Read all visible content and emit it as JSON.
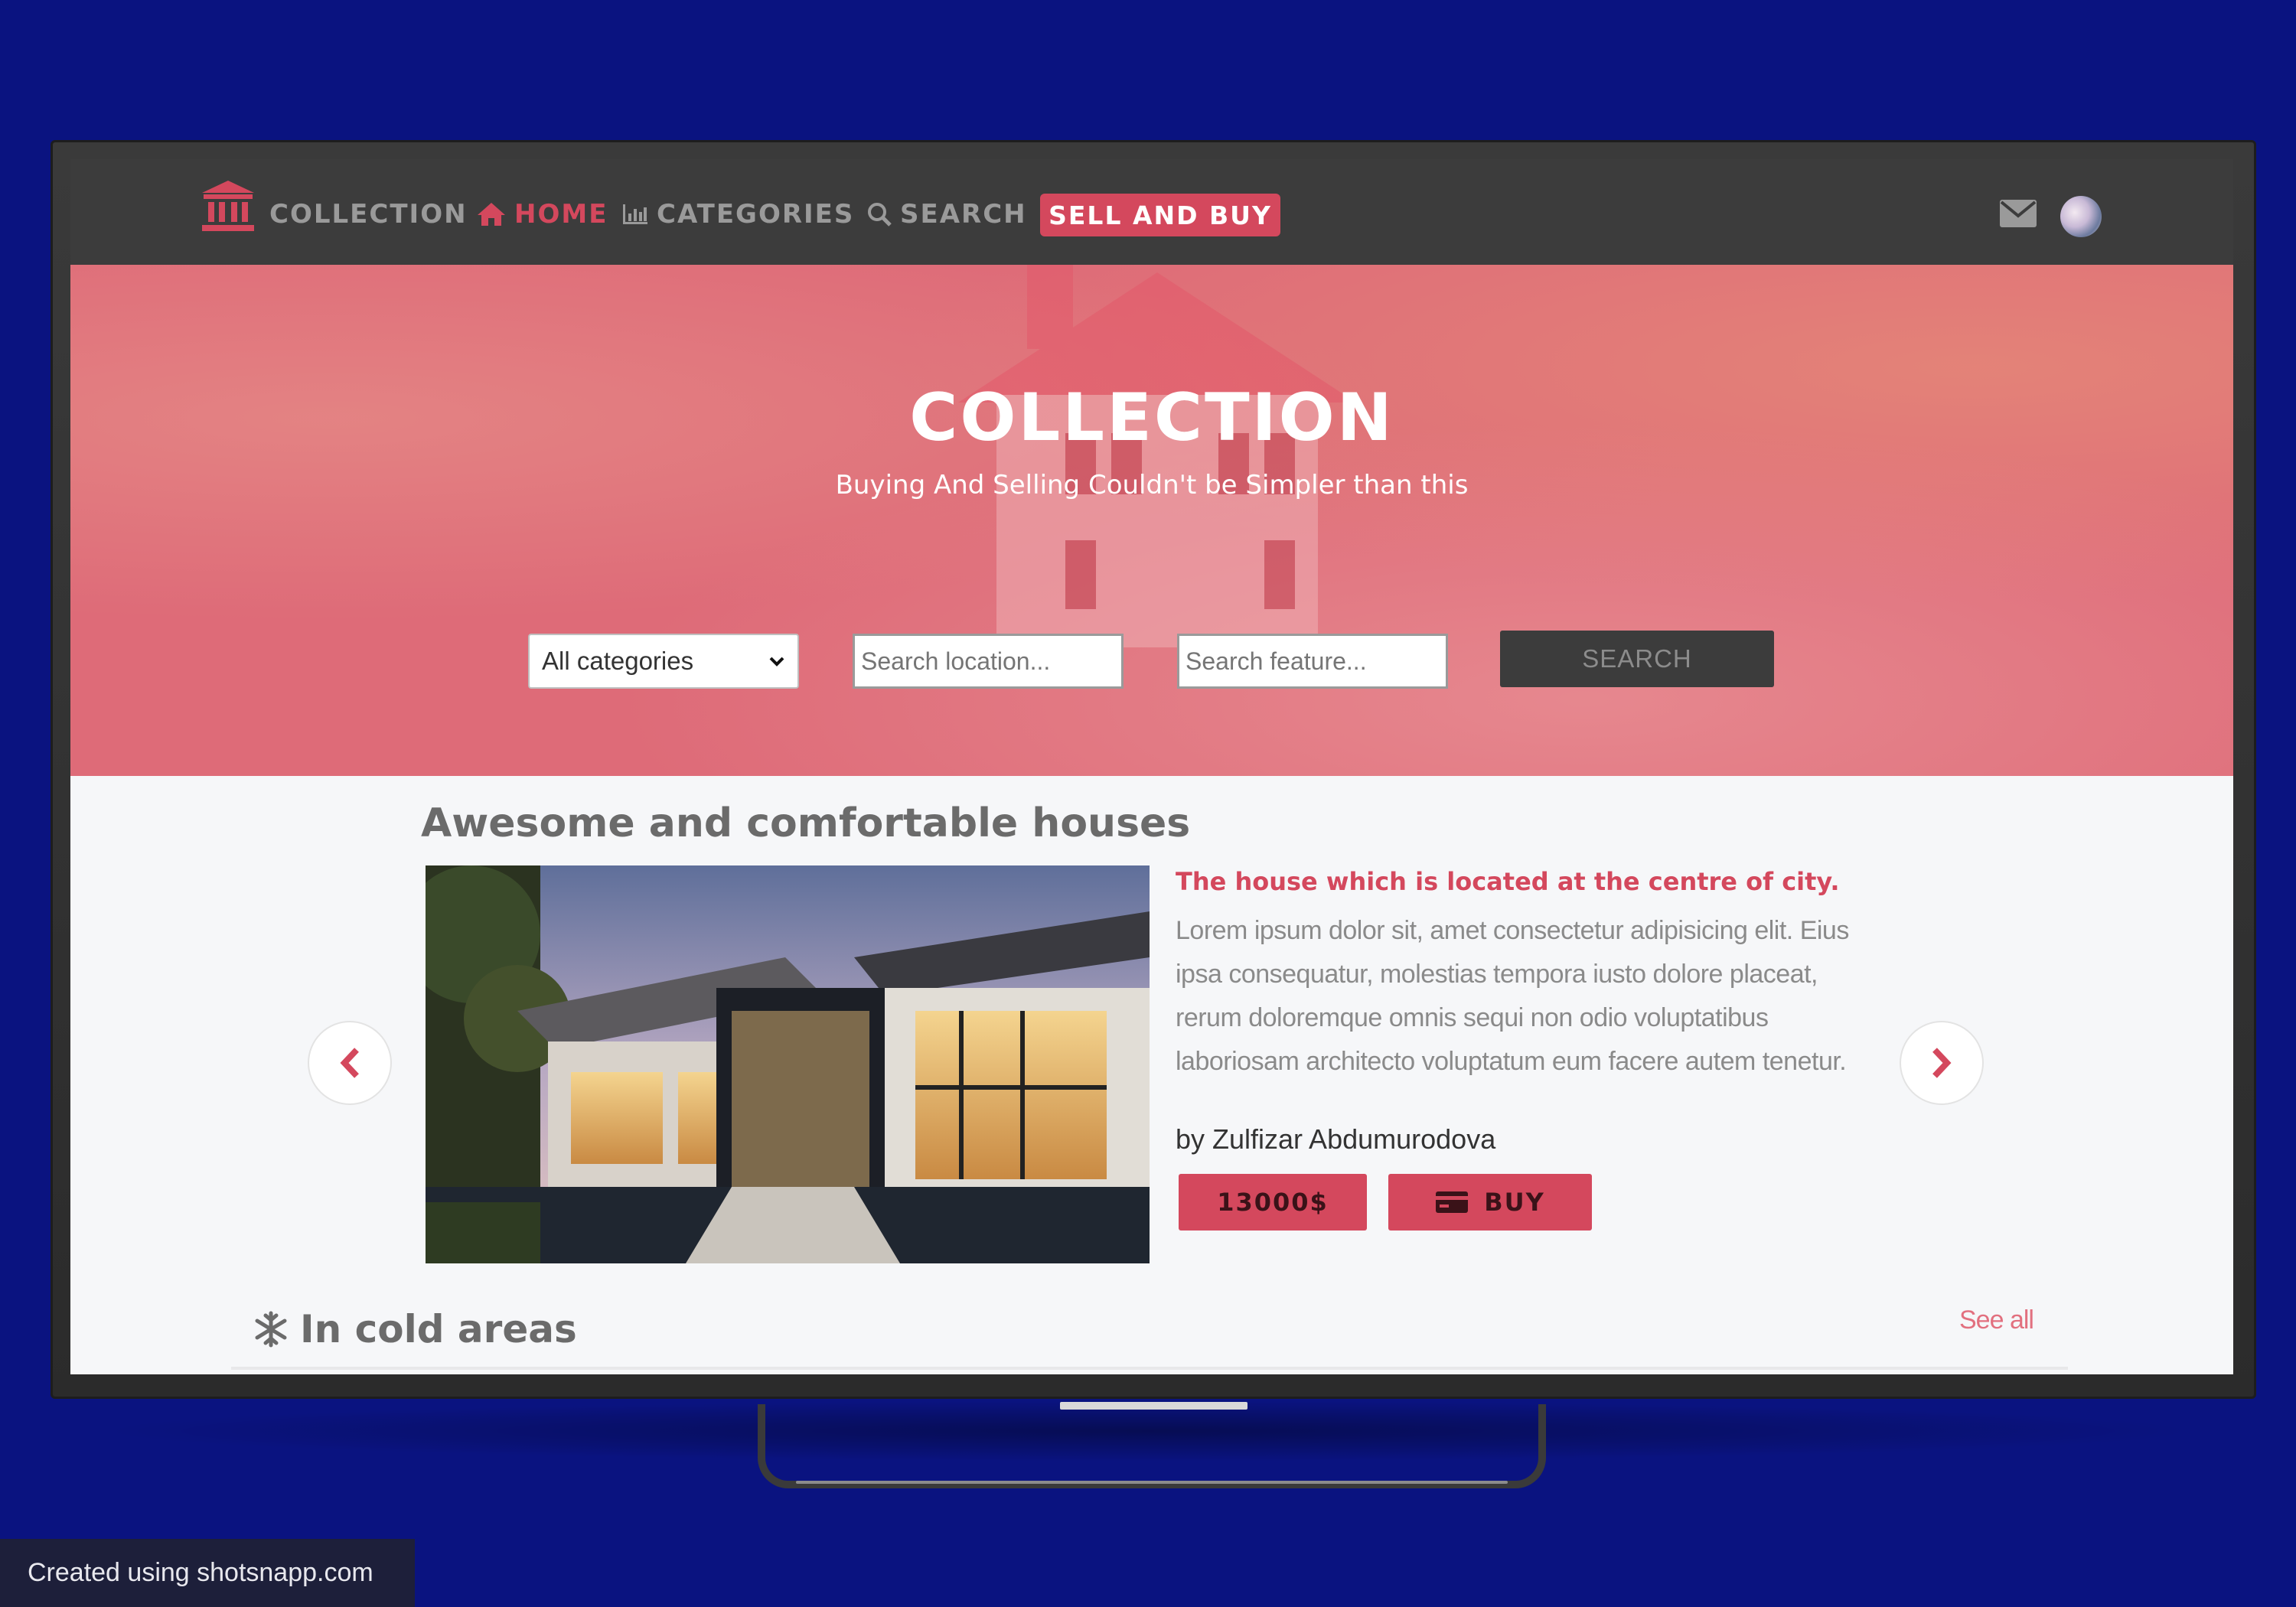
{
  "navbar": {
    "brand": "COLLECTION",
    "home": "HOME",
    "categories": "CATEGORIES",
    "search": "SEARCH",
    "sell_and_buy": "SELL AND BUY"
  },
  "hero": {
    "title": "COLLECTION",
    "subtitle": "Buying And Selling Couldn't be Simpler than this",
    "category_select": "All categories",
    "location_placeholder": "Search location...",
    "feature_placeholder": "Search feature...",
    "search_button": "SEARCH"
  },
  "featured": {
    "section_title": "Awesome and comfortable houses",
    "card_title": "The house which is located at the centre of city.",
    "card_text": "Lorem ipsum dolor sit, amet consectetur adipisicing elit. Eius ipsa consequatur, molestias tempora iusto dolore placeat, rerum doloremque omnis sequi non odio voluptatibus laboriosam architecto voluptatum eum facere autem tenetur.",
    "author": "by Zulfizar Abdumurodova",
    "price": "13000$",
    "buy": "BUY"
  },
  "cold_areas": {
    "title": "In cold areas",
    "see_all": "See all"
  },
  "watermark": "Created using shotsnapp.com",
  "colors": {
    "accent": "#d4485d",
    "navbar": "#3c3c3c",
    "background": "#0a1380"
  },
  "icons": [
    "bank-icon",
    "home-icon",
    "bar-chart-icon",
    "search-icon",
    "envelope-icon",
    "chevron-left-icon",
    "chevron-right-icon",
    "credit-card-icon",
    "snowflake-icon"
  ]
}
